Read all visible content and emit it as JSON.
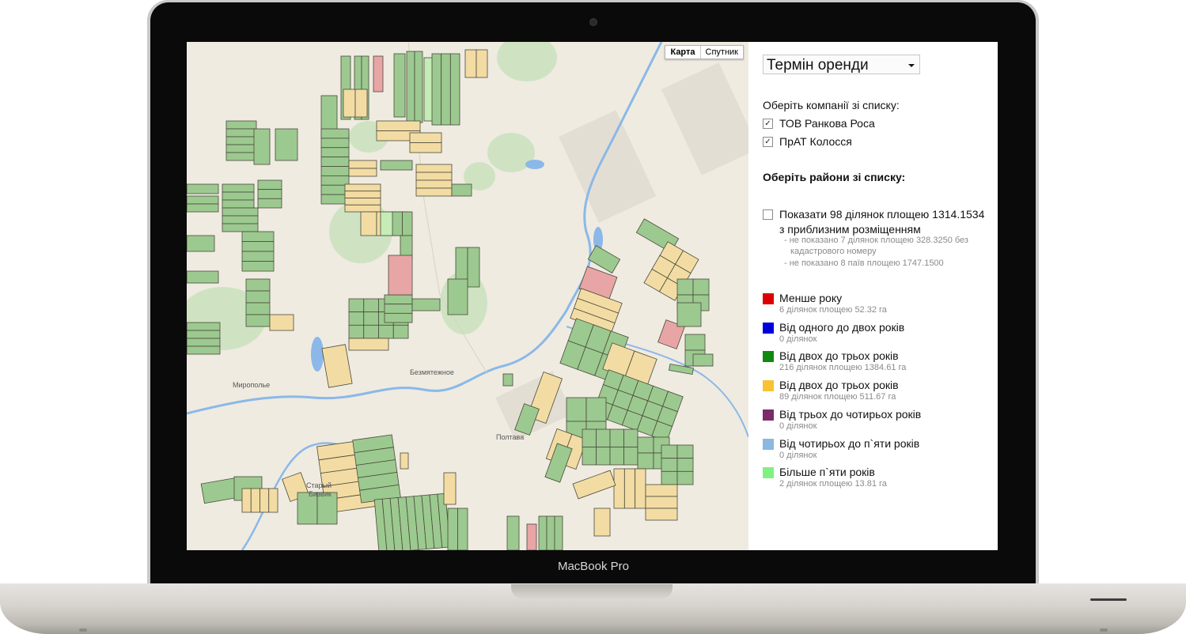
{
  "device": {
    "brand": "MacBook Pro"
  },
  "map": {
    "type_control": {
      "map_label": "Карта",
      "satellite_label": "Спутник"
    },
    "places": {
      "miropolie": "Мирополье",
      "bezmyatezhnoe": "Безмятежное",
      "poltava": "Полтава",
      "stary": "Старый",
      "bizvik": "Бизвик"
    },
    "colors": {
      "background": "#efebe1",
      "green_plot": "#9cc98f",
      "yellow_plot": "#f3dca3",
      "red_plot": "#e8a5a5",
      "light_green_plot": "#c5ecb6",
      "water": "#8bb8e8",
      "park": "#cfe3c3"
    }
  },
  "panel": {
    "dropdown": {
      "selected": "Термін оренди"
    },
    "companies_heading": "Оберіть компанії зі списку:",
    "companies": [
      {
        "label": "ТОВ Ранкова Роса",
        "checked": true
      },
      {
        "label": "ПрАТ Колосся",
        "checked": true
      }
    ],
    "districts_heading": "Оберіть райони зі списку:",
    "approx": {
      "label_line1": "Показати 98 ділянок площею 1314.1534",
      "label_line2": "з приблизним розміщенням",
      "checked": false,
      "note1_line1": "- не показано 7 ділянок площею 328.3250 без",
      "note1_line2": "кадастрового номеру",
      "note2": "- не показано 8 паїв площею 1747.1500"
    },
    "legend": [
      {
        "label": "Менше року",
        "sub": "6 ділянок площею 52.32 га",
        "color": "#dd0000"
      },
      {
        "label": "Від одного до двох років",
        "sub": "0 ділянок",
        "color": "#0000dd"
      },
      {
        "label": "Від двох до трьох років",
        "sub": "216 ділянок площею 1384.61 га",
        "color": "#118811"
      },
      {
        "label": "Від двох до трьох років",
        "sub": "89 ділянок площею 511.67 га",
        "color": "#f7c233"
      },
      {
        "label": "Від трьох до чотирьох років",
        "sub": "0 ділянок",
        "color": "#7b2a6a"
      },
      {
        "label": "Від чотирьох до п`яти років",
        "sub": "0 ділянок",
        "color": "#8ab8e0"
      },
      {
        "label": "Більше п`яти років",
        "sub": "2 ділянок площею 13.81 га",
        "color": "#80f080"
      }
    ]
  }
}
